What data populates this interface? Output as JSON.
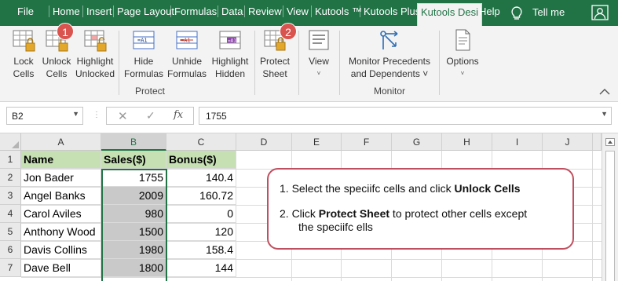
{
  "tabs": [
    "File",
    "Home",
    "Insert",
    "Page Layout",
    "Formulas",
    "Data",
    "Review",
    "View",
    "Kutools ™",
    "Kutools Plus",
    "Kutools Desi",
    "Help"
  ],
  "tell_me": "Tell me",
  "ribbon": {
    "protect_group": {
      "label": "Protect",
      "buttons": [
        {
          "line1": "Lock",
          "line2": "Cells",
          "icon": "lock-cells-icon"
        },
        {
          "line1": "Unlock",
          "line2": "Cells",
          "icon": "unlock-cells-icon"
        },
        {
          "line1": "Highlight",
          "line2": "Unlocked",
          "icon": "highlight-unlocked-icon"
        },
        {
          "line1": "Hide",
          "line2": "Formulas",
          "icon": "hide-formulas-icon"
        },
        {
          "line1": "Unhide",
          "line2": "Formulas",
          "icon": "unhide-formulas-icon"
        },
        {
          "line1": "Highlight",
          "line2": "Hidden",
          "icon": "highlight-hidden-icon"
        },
        {
          "line1": "Protect",
          "line2": "Sheet",
          "icon": "protect-sheet-icon"
        }
      ]
    },
    "view_button": {
      "line1": "View",
      "caret": "˅"
    },
    "monitor_group": {
      "label": "Monitor",
      "line1": "Monitor Precedents",
      "line2": "and Dependents ˅"
    },
    "options_button": {
      "line1": "Options",
      "caret": "˅"
    },
    "badges": [
      "1",
      "2"
    ]
  },
  "formula_bar": {
    "name_box": "B2",
    "cancel_symbol": "✕",
    "enter_symbol": "✓",
    "fx_label": "fx",
    "formula": "1755"
  },
  "grid": {
    "columns": [
      "A",
      "B",
      "C",
      "D",
      "E",
      "F",
      "G",
      "H",
      "I",
      "J"
    ],
    "rows": [
      "1",
      "2",
      "3",
      "4",
      "5",
      "6",
      "7"
    ],
    "header_row": [
      "Name",
      "Sales($)",
      "Bonus($)"
    ],
    "data": [
      [
        "Jon Bader",
        "1755",
        "140.4"
      ],
      [
        "Angel Banks",
        "2009",
        "160.72"
      ],
      [
        "Carol Aviles",
        "980",
        "0"
      ],
      [
        "Anthony Wood",
        "1500",
        "120"
      ],
      [
        "Davis Collins",
        "1980",
        "158.4"
      ],
      [
        "Dave Bell",
        "1800",
        "144"
      ]
    ]
  },
  "callout": {
    "step1_prefix": "1. Select the speciifc cells and click ",
    "step1_bold": "Unlock Cells",
    "step2_prefix": "2. Click ",
    "step2_bold": "Protect Sheet",
    "step2_suffix": " to protect other cells except",
    "step2_line2": "the speciifc ells"
  },
  "colors": {
    "excel_green": "#217346",
    "header_fill": "#c6e0b4",
    "selection_fill": "#c9c9c9",
    "callout_border": "#c0505f",
    "badge": "#d9534f"
  }
}
